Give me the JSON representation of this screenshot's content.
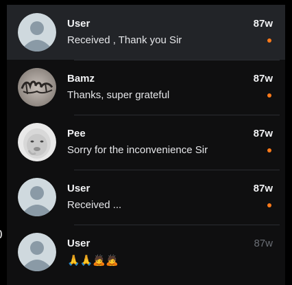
{
  "conversations": [
    {
      "name": "User",
      "message": "Received , Thank you Sir",
      "time": "87w",
      "unread": true,
      "selected": true,
      "avatar": "default-user-avatar"
    },
    {
      "name": "Bamz",
      "message": "Thanks, super grateful",
      "time": "87w",
      "unread": true,
      "selected": false,
      "avatar": "bamz-graffiti-avatar"
    },
    {
      "name": "Pee",
      "message": "Sorry for the inconvenience Sir",
      "time": "87w",
      "unread": true,
      "selected": false,
      "avatar": "baby-photo-avatar"
    },
    {
      "name": "User",
      "message": "Received ...",
      "time": "87w",
      "unread": true,
      "selected": false,
      "avatar": "default-user-avatar"
    },
    {
      "name": "User",
      "message": "🙏🙏🙇🙇",
      "time": "87w",
      "unread": false,
      "selected": false,
      "avatar": "default-user-avatar"
    }
  ],
  "colors": {
    "unread_dot": "#ff7a1a",
    "selected_row": "#222428",
    "background": "#0f0f10"
  }
}
